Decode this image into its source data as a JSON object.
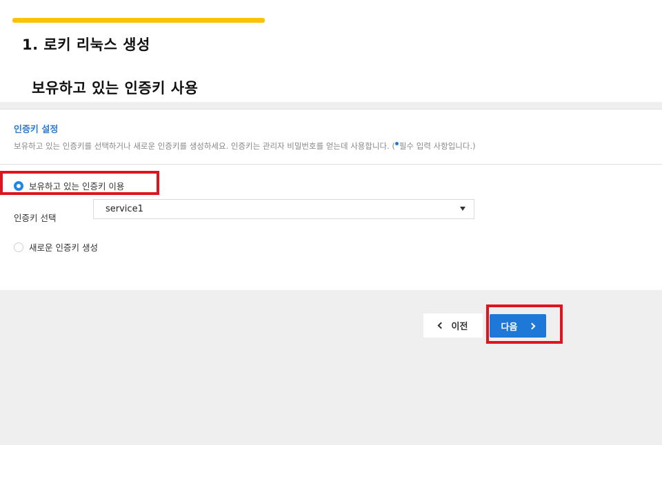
{
  "slide": {
    "title": "1. 로키 리눅스 생성",
    "subtitle": "보유하고 있는 인증키 사용",
    "accent_color": "#f9c300",
    "highlight_color": "#e0141e"
  },
  "panel": {
    "title": "인증키 설정",
    "description_pre": "보유하고 있는 인증키를 선택하거나 새로운 인증키를 생성하세요. 인증키는 관리자 비밀번호를 얻는데 사용합니다. (",
    "description_post": "필수 입력 사항입니다.)",
    "title_color": "#2c7bd1"
  },
  "options": {
    "existing_label": "보유하고 있는 인증키 이용",
    "existing_selected": true,
    "new_label": "새로운 인증키 생성",
    "new_selected": false
  },
  "select": {
    "label": "인증키 선택",
    "value": "service1"
  },
  "buttons": {
    "prev_label": "이전",
    "next_label": "다음",
    "primary_color": "#1e78d8"
  }
}
